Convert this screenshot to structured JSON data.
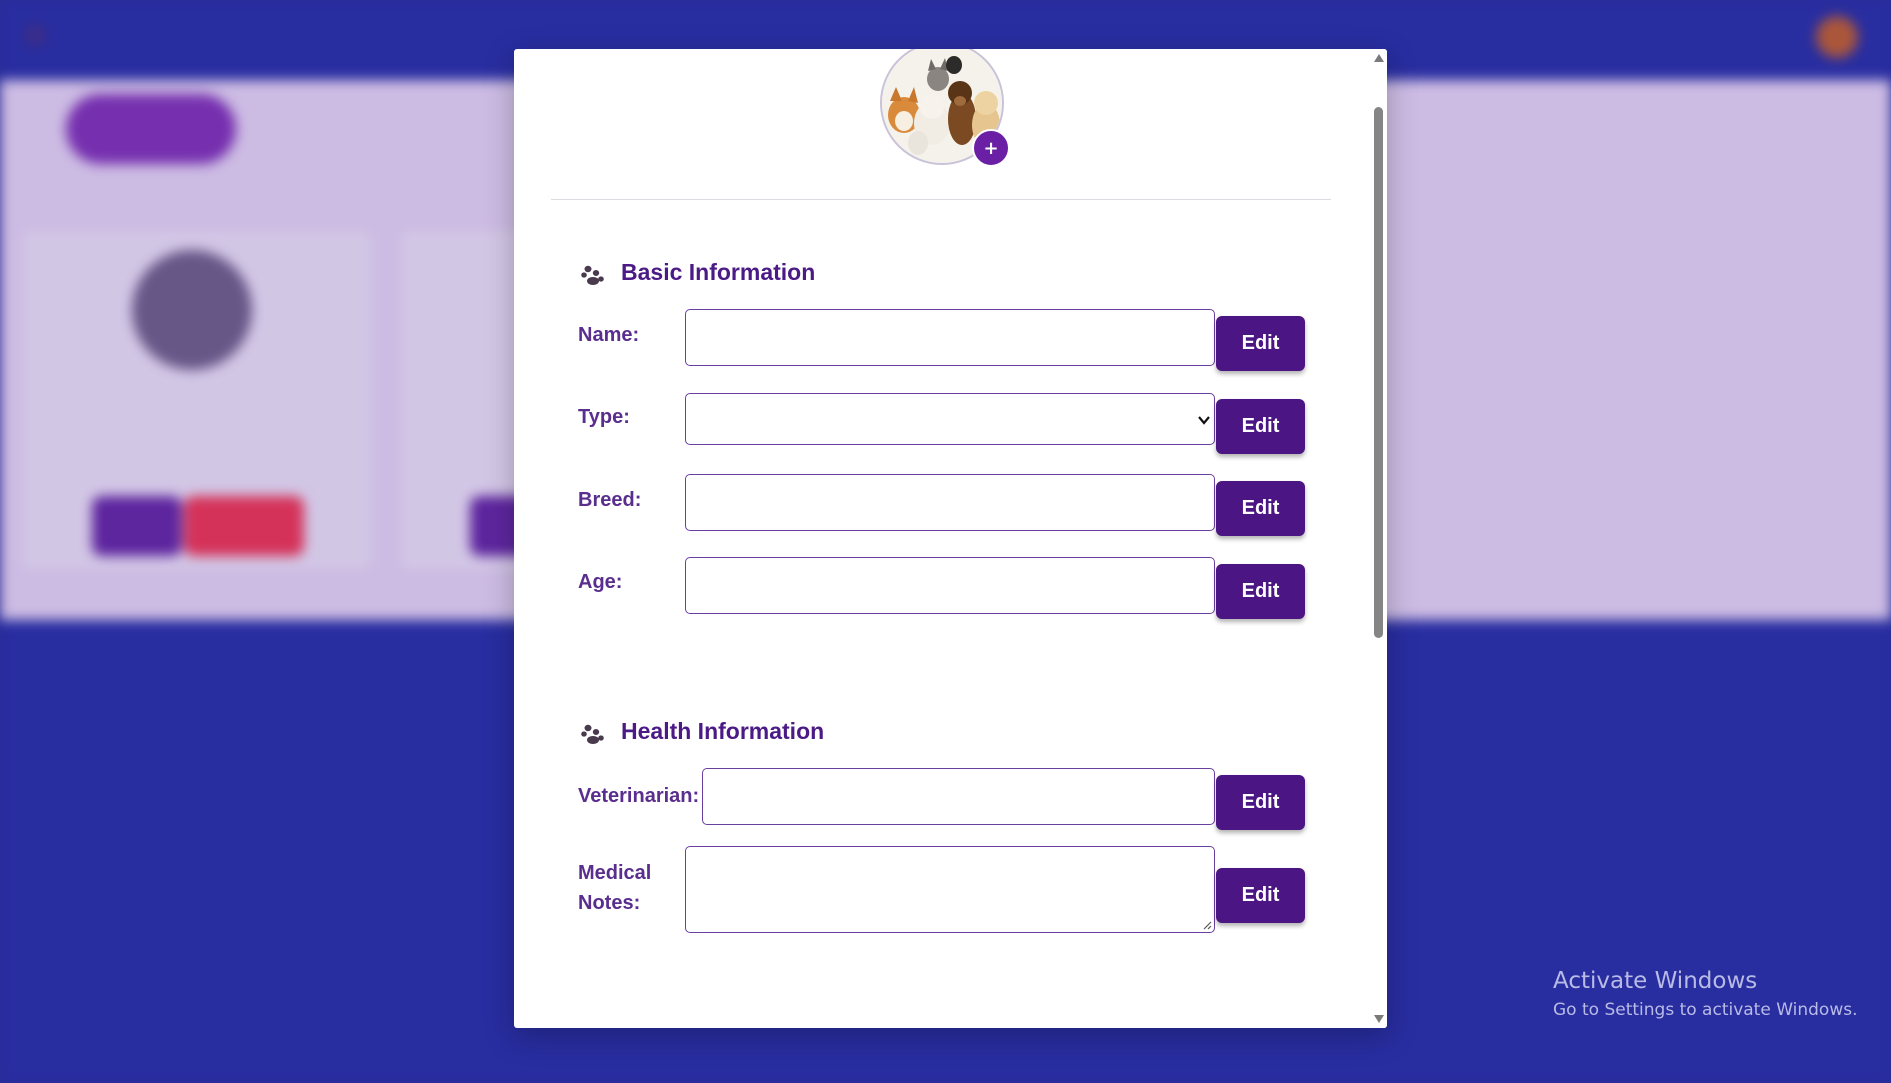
{
  "modal": {
    "photo_add_label": "+",
    "basic_section_title": "Basic Information",
    "health_section_title": "Health Information",
    "fields": {
      "name": {
        "label": "Name:",
        "value": ""
      },
      "type": {
        "label": "Type:",
        "value": ""
      },
      "breed": {
        "label": "Breed:",
        "value": ""
      },
      "age": {
        "label": "Age:",
        "value": ""
      },
      "veterinarian": {
        "label": "Veterinarian:",
        "value": ""
      },
      "medical_notes": {
        "label_line1": "Medical",
        "label_line2": "Notes:",
        "value": ""
      }
    },
    "edit_label": "Edit"
  },
  "watermark": {
    "title": "Activate Windows",
    "subtitle": "Go to Settings to activate Windows."
  },
  "colors": {
    "accent_purple": "#4b1583",
    "section_title": "#4b1a86",
    "background_blue": "#2a2fa6",
    "background_lavender": "#d6c4ec"
  },
  "icons": [
    "paw-icon",
    "plus-icon",
    "chevron-down-icon",
    "scroll-up-arrow-icon",
    "scroll-down-arrow-icon"
  ]
}
